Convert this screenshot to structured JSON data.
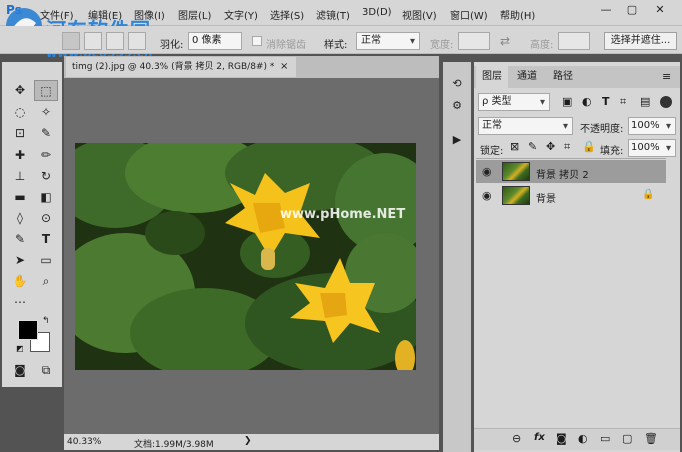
{
  "app": {
    "logo": "Ps"
  },
  "watermarks": {
    "top_left": "河东软件园",
    "top_left_url": "www.pc0359.cn",
    "center": "www.pHome.NET"
  },
  "menu": [
    "文件(F)",
    "编辑(E)",
    "图像(I)",
    "图层(L)",
    "文字(Y)",
    "选择(S)",
    "滤镜(T)",
    "3D(D)",
    "视图(V)",
    "窗口(W)",
    "帮助(H)"
  ],
  "window_controls": {
    "minimize": "—",
    "restore": "▢",
    "close": "✕"
  },
  "options": {
    "feather_label": "羽化:",
    "feather_value": "0 像素",
    "antialias_label": "消除锯齿",
    "style_label": "样式:",
    "style_value": "正常",
    "width_label": "宽度:",
    "height_label": "高度:",
    "select_mask_button": "选择并遮住..."
  },
  "tools": [
    "✥",
    "◌",
    "⊡",
    "✎",
    "✚",
    "▬",
    "⊕",
    "⊙",
    "✎",
    "T",
    "➤",
    "▭",
    "✋",
    "⌕",
    "⋯"
  ],
  "document": {
    "tab_title": "timg (2).jpg @ 40.3% (背景 拷贝 2, RGB/8#) *",
    "close": "×",
    "zoom": "40.33%",
    "doc_info": "文档:1.99M/3.98M",
    "status_arrow": "❯"
  },
  "panels": {
    "tabs": [
      "图层",
      "通道",
      "路径"
    ],
    "menu_icon": "≡",
    "kind_filter": "ρ 类型",
    "blend_mode": "正常",
    "opacity_label": "不透明度:",
    "opacity_value": "100%",
    "lock_label": "锁定:",
    "fill_label": "填充:",
    "fill_value": "100%",
    "layers": [
      {
        "name": "背景 拷贝 2",
        "selected": true
      },
      {
        "name": "背景",
        "selected": false,
        "locked": true
      }
    ],
    "bottom_icons": [
      "⊖",
      "fx",
      "◙",
      "◐",
      "▭",
      "▢",
      "🗑"
    ]
  },
  "colors": {
    "foreground": "#000000",
    "background": "#ffffff",
    "accent": "#1e6fd0"
  }
}
